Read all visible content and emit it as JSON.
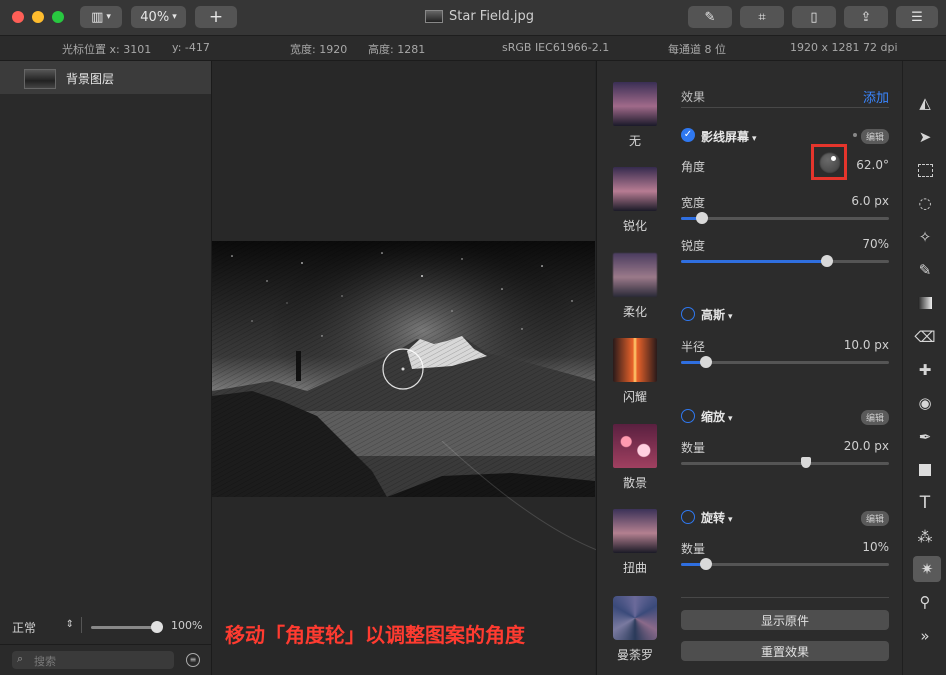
{
  "window": {
    "title": "Star Field.jpg",
    "zoom": "40%"
  },
  "infobar": {
    "cursor_x": "光标位置 x:  3101",
    "cursor_y": "y:  -417",
    "width": "宽度:  1920",
    "height": "高度:  1281",
    "colorspace": "sRGB IEC61966-2.1",
    "depth": "每通道 8 位",
    "dims": "1920 x 1281 72 dpi"
  },
  "layers": {
    "items": [
      {
        "name": "背景图层"
      }
    ]
  },
  "left_footer": {
    "blend_mode": "正常",
    "opacity": "100%",
    "opacity_value": 1.0,
    "search_placeholder": "搜索"
  },
  "presets": [
    "无",
    "锐化",
    "柔化",
    "闪耀",
    "散景",
    "扭曲",
    "曼荼罗"
  ],
  "effects": {
    "header": "效果",
    "add": "添加",
    "edit": "编辑",
    "lines": {
      "name": "影线屏幕",
      "checked": true,
      "angle_label": "角度",
      "angle_value": "62.0°",
      "width_label": "宽度",
      "width_value": "6.0 px",
      "width_level": 0.1,
      "sharp_label": "锐度",
      "sharp_value": "70%",
      "sharp_level": 0.7
    },
    "gauss": {
      "name": "高斯",
      "radius_label": "半径",
      "radius_value": "10.0 px",
      "radius_level": 0.12
    },
    "zoom": {
      "name": "缩放",
      "amount_label": "数量",
      "amount_value": "20.0 px",
      "amount_level": 0.6
    },
    "twirl": {
      "name": "旋转",
      "amount_label": "数量",
      "amount_value": "10%",
      "amount_level": 0.12
    },
    "show_original": "显示原件",
    "reset": "重置效果"
  },
  "caption": "移动「角度轮」以调整图案的角度",
  "colors": {
    "accent": "#2f78f0",
    "highlight": "#e5352c",
    "caption": "#ff3b30"
  }
}
